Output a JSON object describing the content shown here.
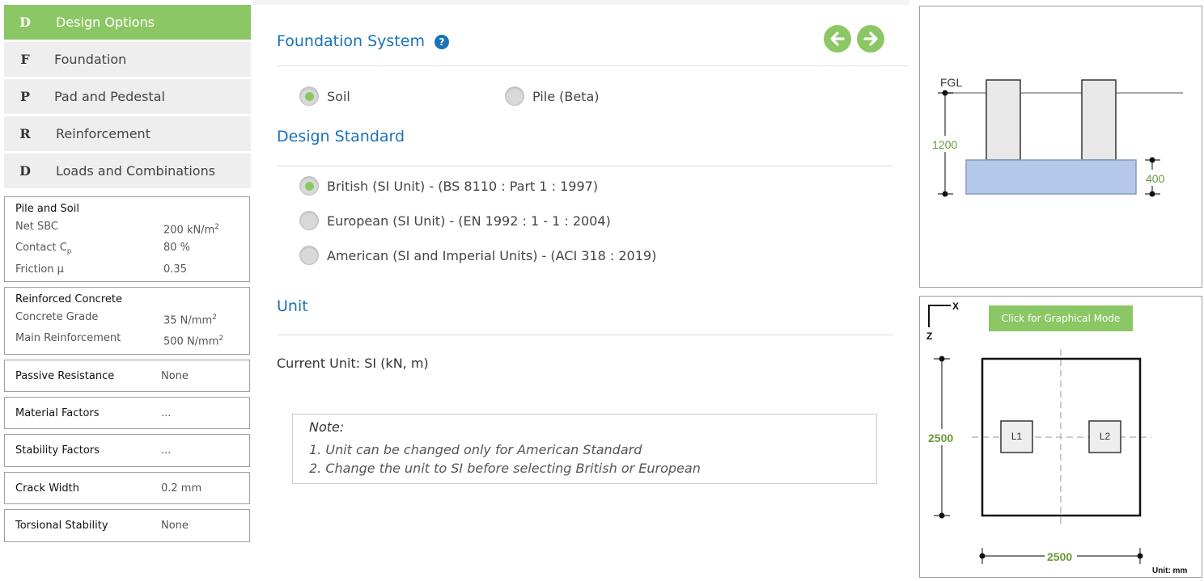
{
  "nav": {
    "items": [
      {
        "letter": "D",
        "label": "Design Options",
        "active": true
      },
      {
        "letter": "F",
        "label": "Foundation",
        "active": false
      },
      {
        "letter": "P",
        "label": "Pad and Pedestal",
        "active": false
      },
      {
        "letter": "R",
        "label": "Reinforcement",
        "active": false
      },
      {
        "letter": "D",
        "label": "Loads and Combinations",
        "active": false
      }
    ]
  },
  "pile_soil": {
    "title": "Pile and Soil",
    "rows": [
      {
        "label": "Net SBC",
        "value": "200 kN/m",
        "sup": "2"
      },
      {
        "label": "Contact C",
        "sub": "p",
        "value": "80 %"
      },
      {
        "label": "Friction μ",
        "value": "0.35"
      }
    ]
  },
  "reinforced_concrete": {
    "title": "Reinforced Concrete",
    "rows": [
      {
        "label": "Concrete Grade",
        "value": "35 N/mm",
        "sup": "2"
      },
      {
        "label": "Main Reinforcement",
        "value": "500 N/mm",
        "sup": "2"
      }
    ]
  },
  "summary": [
    {
      "label": "Passive Resistance",
      "value": "None"
    },
    {
      "label": "Material Factors",
      "value": "..."
    },
    {
      "label": "Stability Factors",
      "value": "..."
    },
    {
      "label": "Crack Width",
      "value": "0.2 mm"
    },
    {
      "label": "Torsional Stability",
      "value": "None"
    }
  ],
  "foundation_system": {
    "heading": "Foundation System",
    "help": "?",
    "options": [
      {
        "label": "Soil",
        "selected": true
      },
      {
        "label": "Pile (Beta)",
        "selected": false
      }
    ]
  },
  "design_standard": {
    "heading": "Design Standard",
    "options": [
      {
        "label": "British (SI Unit) - (BS 8110 : Part 1 : 1997)",
        "selected": true
      },
      {
        "label": "European (SI Unit) - (EN 1992 : 1 - 1 : 2004)",
        "selected": false
      },
      {
        "label": "American (SI and Imperial Units) - (ACI 318 : 2019)",
        "selected": false
      }
    ]
  },
  "unit": {
    "heading": "Unit",
    "current": "Current Unit: SI (kN, m)"
  },
  "note": {
    "title": "Note:",
    "lines": [
      "1. Unit can be changed only for American Standard",
      "2. Change the unit to SI before selecting British or European"
    ]
  },
  "elevation": {
    "fgl": "FGL",
    "depth": "1200",
    "thickness": "400"
  },
  "plan": {
    "axis_x": "X",
    "axis_z": "Z",
    "button": "Click for Graphical Mode",
    "length": "2500",
    "width": "2500",
    "col1": "L1",
    "col2": "L2",
    "unit": "Unit: mm"
  },
  "colors": {
    "accent_green": "#8cc765",
    "heading_blue": "#1a72b8",
    "pad_fill": "#b4c8ea",
    "dim_green": "#6a9a3a"
  }
}
